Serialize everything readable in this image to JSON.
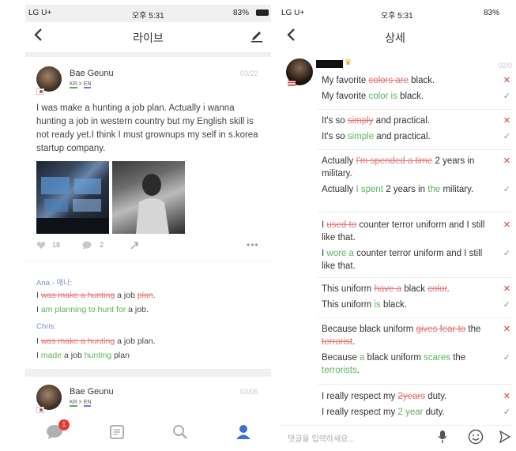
{
  "left": {
    "status": {
      "carrier": "LG U+",
      "time": "오후 5:31",
      "battery": "83%"
    },
    "nav": {
      "title": "라이브"
    },
    "post1": {
      "username": "Bae Geunu",
      "lang_from": "KR",
      "lang_arrow": ">",
      "lang_to": "EN",
      "date": "03/22",
      "text": "I was make a hunting a job plan. Actually i wanna hunting a job in western country but my English skill is not ready yet.I think I must grownups my self in s.korea startup company.",
      "likes": "18",
      "comments": "2"
    },
    "corrections": {
      "ana_name": "Ana - 애나:",
      "c1_orig": {
        "pre": "I ",
        "del1": "was make a hunting",
        "mid": " a job ",
        "del2": "plan",
        "end": "."
      },
      "c1_fix": {
        "pre": "I ",
        "add1": "am planning to hunt for",
        "end": " a job."
      },
      "chris_name": "Chris:",
      "c2_orig": {
        "pre": "I ",
        "del1": "was make a hunting",
        "end": " a job plan."
      },
      "c2_fix": {
        "pre": "I ",
        "add1": "made",
        "mid": " a job ",
        "add2": "hunting",
        "end": "  plan"
      }
    },
    "post2": {
      "username": "Bae Geunu",
      "lang_from": "KR",
      "lang_arrow": ">",
      "lang_to": "EN",
      "date": "03/05"
    },
    "tabbar": {
      "badge": "1"
    }
  },
  "right": {
    "status": {
      "carrier": "LG U+",
      "time": "오후 5:31",
      "battery": "83%"
    },
    "nav": {
      "title": "상세"
    },
    "date": "02/0",
    "items": [
      {
        "orig": [
          [
            "My favorite ",
            ""
          ],
          [
            "colors are",
            "del"
          ],
          [
            " black.",
            ""
          ]
        ],
        "fix": [
          [
            "My favorite ",
            ""
          ],
          [
            "color is",
            "add"
          ],
          [
            " black.",
            ""
          ]
        ]
      },
      {
        "orig": [
          [
            "It's so ",
            ""
          ],
          [
            "simply",
            "del"
          ],
          [
            " and practical.",
            ""
          ]
        ],
        "fix": [
          [
            "It's so ",
            ""
          ],
          [
            "simple",
            "add"
          ],
          [
            " and practical.",
            ""
          ]
        ]
      },
      {
        "orig": [
          [
            "Actually ",
            ""
          ],
          [
            "I'm spended a time",
            "del"
          ],
          [
            " 2 years in military.",
            ""
          ]
        ],
        "fix": [
          [
            "Actually ",
            ""
          ],
          [
            "I spent",
            "add"
          ],
          [
            " 2 years in ",
            ""
          ],
          [
            "the",
            "add"
          ],
          [
            " military.",
            ""
          ]
        ]
      },
      {
        "orig": [
          [
            "I ",
            ""
          ],
          [
            "used to",
            "del"
          ],
          [
            " counter terror uniform and I still like that.",
            ""
          ]
        ],
        "fix": [
          [
            "I ",
            ""
          ],
          [
            "wore a",
            "add"
          ],
          [
            " counter terror uniform and I still like that.",
            ""
          ]
        ]
      },
      {
        "orig": [
          [
            "This uniform ",
            ""
          ],
          [
            "have a",
            "del"
          ],
          [
            " black ",
            ""
          ],
          [
            "color",
            "del"
          ],
          [
            ".",
            ""
          ]
        ],
        "fix": [
          [
            "This uniform ",
            ""
          ],
          [
            "is",
            "add"
          ],
          [
            " black.",
            ""
          ]
        ]
      },
      {
        "orig": [
          [
            "Because black uniform ",
            ""
          ],
          [
            "gives fear to",
            "del"
          ],
          [
            " the ",
            ""
          ],
          [
            "terrorist",
            "del"
          ],
          [
            ".",
            ""
          ]
        ],
        "fix": [
          [
            "Because ",
            ""
          ],
          [
            "a",
            "add"
          ],
          [
            " black uniform ",
            ""
          ],
          [
            "scares",
            "add"
          ],
          [
            " the ",
            ""
          ],
          [
            "terrorists",
            "add"
          ],
          [
            ".",
            ""
          ]
        ]
      },
      {
        "orig": [
          [
            "I really respect my ",
            ""
          ],
          [
            "2years",
            "del"
          ],
          [
            " duty.",
            ""
          ]
        ],
        "fix": [
          [
            "I really respect my ",
            ""
          ],
          [
            "2 year",
            "add"
          ],
          [
            " duty.",
            ""
          ]
        ]
      }
    ],
    "input_placeholder": "댓글을 입력하세요..."
  },
  "colors": {
    "delete": "#e57373",
    "add": "#5ab45a",
    "accent": "#3b6fd8",
    "badge": "#e53935"
  },
  "icons": [
    "back-arrow-icon",
    "edit-pencil-icon",
    "heart-icon",
    "comment-icon",
    "wrench-icon",
    "more-icon",
    "chat-icon",
    "document-icon",
    "search-icon",
    "profile-icon",
    "microphone-icon",
    "smiley-icon",
    "send-icon",
    "crown-icon",
    "x-mark-icon",
    "check-mark-icon"
  ]
}
